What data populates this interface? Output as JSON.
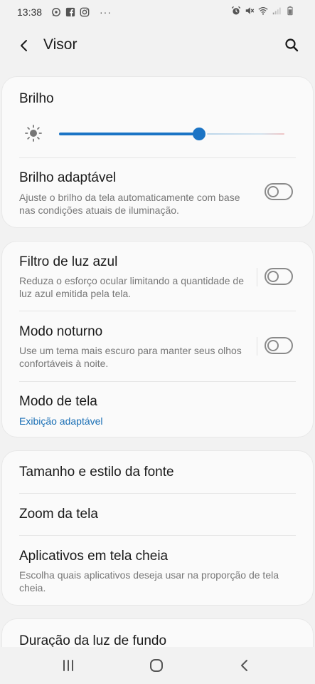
{
  "status_bar": {
    "time": "13:38",
    "left_icons": [
      "whatsapp-icon",
      "facebook-icon",
      "instagram-icon"
    ],
    "overflow": "···",
    "right_icons": [
      "alarm-icon",
      "mute-icon",
      "wifi-icon",
      "signal-icon",
      "battery-icon"
    ]
  },
  "appbar": {
    "title": "Visor",
    "back_icon": "chevron-left-icon",
    "search_icon": "search-icon"
  },
  "brightness": {
    "title": "Brilho",
    "level": 0.62,
    "accent": "#1b74c5"
  },
  "adaptive_brightness": {
    "title": "Brilho adaptável",
    "subtitle": "Ajuste o brilho da tela automaticamente com base nas condições atuais de iluminação.",
    "enabled": false
  },
  "blue_light": {
    "title": "Filtro de luz azul",
    "subtitle": "Reduza o esforço ocular limitando a quantidade de luz azul emitida pela tela.",
    "enabled": false
  },
  "night_mode": {
    "title": "Modo noturno",
    "subtitle": "Use um tema mais escuro para manter seus olhos confortáveis à noite.",
    "enabled": false
  },
  "screen_mode": {
    "title": "Modo de tela",
    "value": "Exibição adaptável"
  },
  "font": {
    "title": "Tamanho e estilo da fonte"
  },
  "zoom": {
    "title": "Zoom da tela"
  },
  "fullscreen_apps": {
    "title": "Aplicativos em tela cheia",
    "subtitle": "Escolha quais aplicativos deseja usar na proporção de tela cheia."
  },
  "backlight": {
    "title": "Duração da luz de fundo"
  },
  "navbar": {
    "icons": [
      "recents-icon",
      "home-icon",
      "back-icon"
    ]
  }
}
